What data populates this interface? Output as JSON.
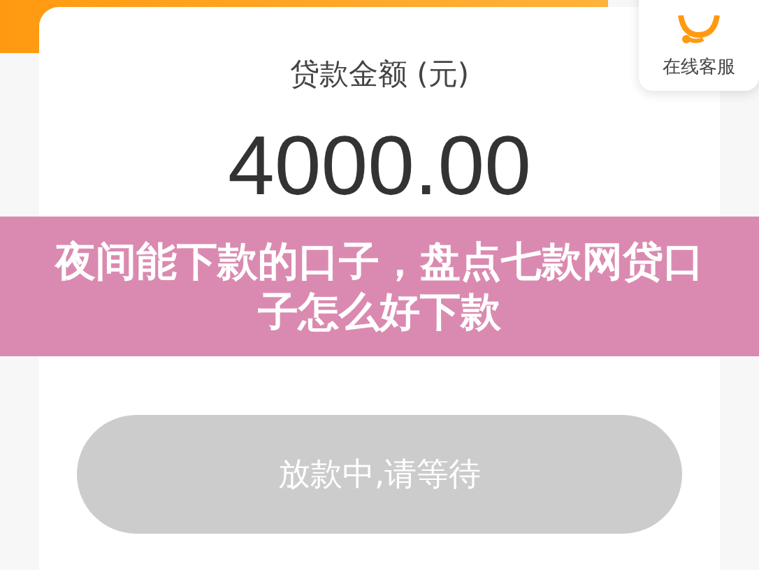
{
  "service_widget": {
    "label": "在线客服"
  },
  "loan": {
    "label": "贷款金额 (元)",
    "amount": "4000.00"
  },
  "banner": {
    "title": "夜间能下款的口子，盘点七款网贷口子怎么好下款"
  },
  "action_button": {
    "label": "放款中,请等待",
    "disabled": true
  }
}
